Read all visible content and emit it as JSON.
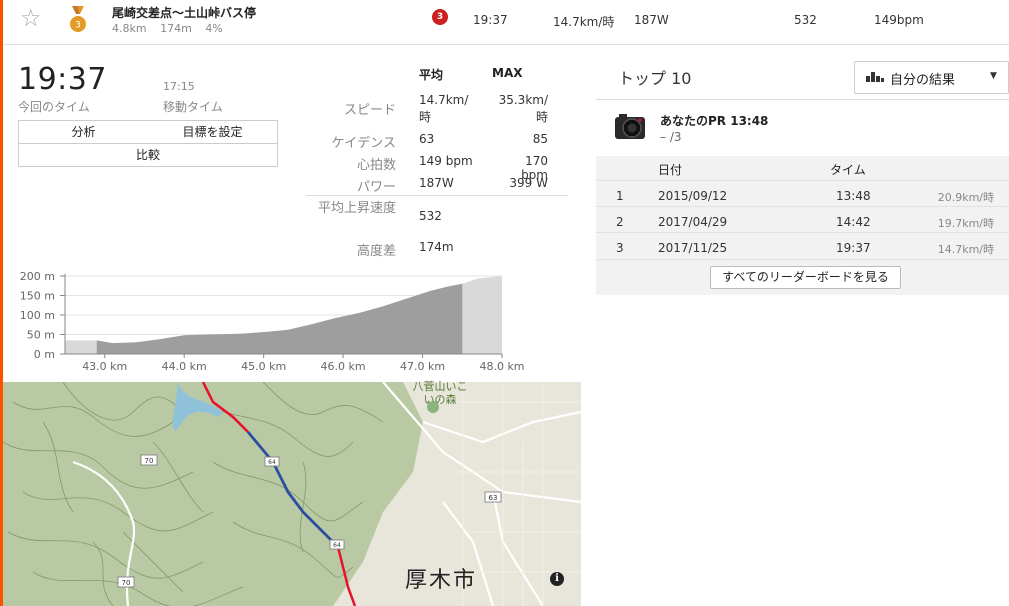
{
  "segment": {
    "name": "尾崎交差点～土山峠バス停",
    "distance": "4.8km",
    "elevation": "174m",
    "grade": "4%",
    "medal_rank": "3",
    "rank": "3",
    "time": "19:37",
    "speed": "14.7km/時",
    "power": "187W",
    "vam": "532",
    "heart_rate": "149bpm"
  },
  "summary": {
    "time": "19:37",
    "time_label": "今回のタイム",
    "moving_time": "17:15",
    "moving_label": "移動タイム"
  },
  "buttons": {
    "analysis": "分析",
    "set_goal": "目標を設定",
    "compare": "比較"
  },
  "stats": {
    "head_avg": "平均",
    "head_max": "MAX",
    "rows": [
      {
        "label": "スピード",
        "avg": "14.7km/時",
        "max": "35.3km/時"
      },
      {
        "label": "ケイデンス",
        "avg": "63",
        "max": "85"
      },
      {
        "label": "心拍数",
        "avg": "149 bpm",
        "max": "170 bpm"
      },
      {
        "label": "パワー",
        "avg": "187W",
        "max": "399 W"
      },
      {
        "label": "平均上昇速度",
        "avg": "532"
      },
      {
        "label": "高度差",
        "avg": "174m"
      }
    ]
  },
  "chart_data": {
    "type": "area",
    "title": "",
    "xlabel": "",
    "ylabel": "",
    "x_ticks": [
      "43.0 km",
      "44.0 km",
      "45.0 km",
      "46.0 km",
      "47.0 km",
      "48.0 km"
    ],
    "y_ticks": [
      "200 m",
      "150 m",
      "100 m",
      "50 m",
      "0 m"
    ],
    "xlim": [
      42.5,
      48.0
    ],
    "ylim": [
      0,
      200
    ],
    "highlight_range": [
      42.9,
      47.5
    ],
    "x": [
      42.5,
      42.9,
      43.1,
      43.4,
      43.7,
      44.0,
      44.3,
      44.7,
      45.0,
      45.3,
      45.6,
      45.9,
      46.2,
      46.5,
      46.8,
      47.1,
      47.3,
      47.5,
      47.7,
      48.0
    ],
    "y": [
      35,
      35,
      28,
      30,
      38,
      48,
      50,
      52,
      56,
      62,
      76,
      92,
      105,
      122,
      142,
      162,
      172,
      180,
      194,
      200
    ],
    "colors": {
      "segment": "#9e9e9e",
      "context": "#d9d9d9"
    }
  },
  "map": {
    "city": "厚木市",
    "forest": "八菅山いこいの森",
    "route_70": "70",
    "route_63": "63",
    "route_64": "64",
    "info": "i"
  },
  "leaderboard": {
    "title": "トップ 10",
    "filter": "自分の結果",
    "pr_title": "あなたのPR 13:48",
    "pr_sub": "– /3",
    "col_date": "日付",
    "col_time": "タイム",
    "rows": [
      {
        "rank": "1",
        "date": "2015/09/12",
        "time": "13:48",
        "speed": "20.9km/時"
      },
      {
        "rank": "2",
        "date": "2017/04/29",
        "time": "14:42",
        "speed": "19.7km/時"
      },
      {
        "rank": "3",
        "date": "2017/11/25",
        "time": "19:37",
        "speed": "14.7km/時"
      }
    ],
    "view_all": "すべてのリーダーボードを見る"
  },
  "colors": {
    "accent": "#fc5200",
    "medal": "#e39b25",
    "rank_badge": "#cc1f1f",
    "route": "#e8102a",
    "route_segment": "#2c4ea0"
  }
}
